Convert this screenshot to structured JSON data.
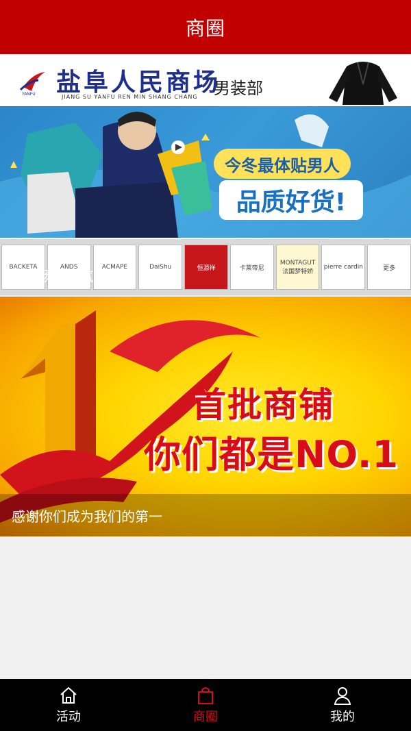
{
  "header": {
    "title": "商圈"
  },
  "cards": [
    {
      "logo_text": "盐阜人民商场",
      "logo_pinyin": "JIANG SU YANFU REN MIN SHANG CHANG",
      "logo_sub": "YANFU",
      "dept": "男装部",
      "slogan_top": "今冬最体贴男人",
      "slogan_bottom": "品质好货!",
      "brands": [
        "BACKETA",
        "ANDS",
        "ACMAPE",
        "DaiShu",
        "恒源祥",
        "卡莱帝尼",
        "MONTAGUT 法国梦特娇",
        "pierre cardin",
        "更多"
      ],
      "caption": "有排场更有气场"
    },
    {
      "big_line1": "首批商铺",
      "big_line2": "你们都是NO.1",
      "caption": "感谢你们成为我们的第一"
    }
  ],
  "tabbar": {
    "items": [
      {
        "label": "活动",
        "icon": "home-icon",
        "active": false
      },
      {
        "label": "商圈",
        "icon": "shopping-bag-icon",
        "active": true
      },
      {
        "label": "我的",
        "icon": "user-icon",
        "active": false
      }
    ]
  },
  "colors": {
    "brand_red": "#c10000",
    "active_tab": "#d80c18",
    "tabbar_bg": "#000000"
  }
}
